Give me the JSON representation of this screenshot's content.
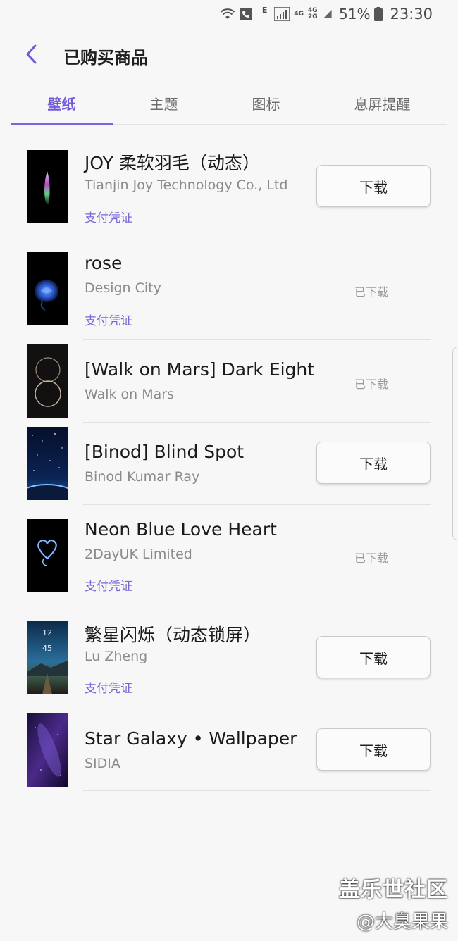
{
  "status_bar": {
    "network_type": "E",
    "net_top": "4G",
    "net_bottom": "4G 2G",
    "battery": "51%",
    "time": "23:30"
  },
  "header": {
    "back_icon": "chevron-left-icon",
    "title": "已购买商品"
  },
  "tabs": [
    {
      "label": "壁纸",
      "active": true
    },
    {
      "label": "主题",
      "active": false
    },
    {
      "label": "图标",
      "active": false
    },
    {
      "label": "息屏提醒",
      "active": false
    }
  ],
  "accent_color": "#7459d9",
  "items": [
    {
      "title": "JOY 柔软羽毛（动态）",
      "publisher": "Tianjin Joy Technology Co., Ltd",
      "receipt": "支付凭证",
      "action": "下载",
      "state": "button"
    },
    {
      "title": "rose",
      "publisher": "Design City",
      "receipt": "支付凭证",
      "action": "已下载",
      "state": "downloaded"
    },
    {
      "title": "[Walk on Mars] Dark Eight",
      "publisher": "Walk on Mars",
      "receipt": "",
      "action": "已下载",
      "state": "downloaded"
    },
    {
      "title": "[Binod] Blind Spot",
      "publisher": "Binod Kumar Ray",
      "receipt": "",
      "action": "下载",
      "state": "button"
    },
    {
      "title": "Neon Blue Love Heart",
      "publisher": "2DayUK Limited",
      "receipt": "支付凭证",
      "action": "已下载",
      "state": "downloaded"
    },
    {
      "title": "繁星闪烁（动态锁屏）",
      "publisher": "Lu Zheng",
      "receipt": "支付凭证",
      "action": "下载",
      "state": "button",
      "thumb_text_1": "12",
      "thumb_text_2": "45"
    },
    {
      "title": "Star Galaxy • Wallpaper",
      "publisher": "SIDIA",
      "receipt": "",
      "action": "下载",
      "state": "button"
    }
  ],
  "watermark": {
    "line1": "盖乐世社区",
    "line2": "@大臭果果"
  }
}
